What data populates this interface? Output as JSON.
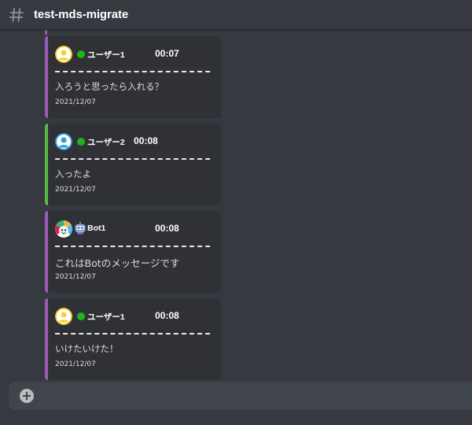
{
  "channel": {
    "icon": "hash-icon",
    "name": "test-mds-migrate"
  },
  "messages": [
    {
      "accent": "#9b59b6",
      "avatar": "yellow-user-avatar",
      "marker": "online-status-dot",
      "username": "ユーザー1",
      "time": "00:07",
      "divider": "--------------------------------------------",
      "body": "入ろうと思ったら入れる？",
      "date": "2021/12/07"
    },
    {
      "accent": "#57b94a",
      "avatar": "blue-user-avatar",
      "marker": "online-status-dot",
      "username": "ユーザー2",
      "time": "00:08",
      "divider": "--------------------------------------------",
      "body": "入ったよ",
      "date": "2021/12/07"
    },
    {
      "accent": "#9b59b6",
      "avatar": "bot-avatar",
      "marker": "robot-icon",
      "username": "Bot1",
      "time": "00:08",
      "divider": "--------------------------------------------",
      "body": "これはBotのメッセージです",
      "date": "2021/12/07"
    },
    {
      "accent": "#9b59b6",
      "avatar": "yellow-user-avatar",
      "marker": "online-status-dot",
      "username": "ユーザー1",
      "time": "00:08",
      "divider": "--------------------------------------------",
      "body": "いけたいけた！",
      "date": "2021/12/07"
    }
  ],
  "composer": {
    "add_icon": "plus-circle-icon"
  },
  "colors": {
    "background": "#36393f",
    "card": "#2f3136",
    "composer": "#40444b",
    "online": "#1fb31f"
  }
}
